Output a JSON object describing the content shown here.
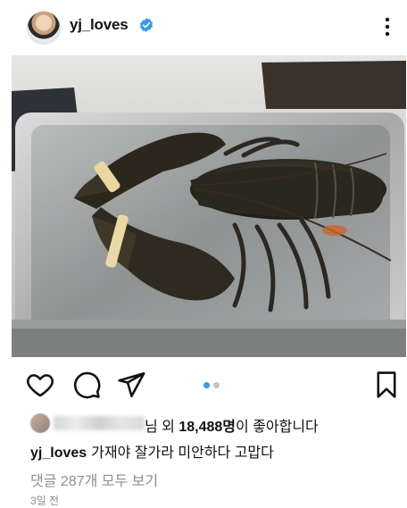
{
  "header": {
    "username": "yj_loves",
    "verified": true,
    "avatar_icon": "profile-avatar",
    "more_icon": "more-vertical-icon"
  },
  "post": {
    "image_icon": "lobster-photo",
    "carousel": {
      "total": 2,
      "active": 1,
      "active_color": "#3897f0",
      "inactive_color": "#c4c4c4"
    }
  },
  "actions": {
    "like_icon": "heart-icon",
    "comment_icon": "comment-icon",
    "share_icon": "send-icon",
    "save_icon": "bookmark-icon"
  },
  "likes": {
    "suffix": "님 외 ",
    "count": "18,488명",
    "tail": "이 좋아합니다"
  },
  "caption": {
    "username": "yj_loves",
    "text": "가재야 잘가라 미안하다 고맙다"
  },
  "comments": {
    "view_all": "댓글 287개 모두 보기"
  },
  "timestamp": "3일 전",
  "colors": {
    "text": "#111111",
    "muted": "#8e8e8e",
    "verified_blue": "#3897f0"
  }
}
